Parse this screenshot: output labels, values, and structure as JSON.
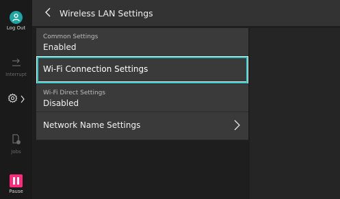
{
  "sidebar": {
    "logout_label": "Log Out",
    "interrupt_label": "Interrupt",
    "jobs_label": "Jobs",
    "pause_label": "Pause",
    "logout_color": "#1ea4a4",
    "pause_color": "#ff2b7a"
  },
  "header": {
    "title": "Wireless LAN Settings"
  },
  "settings": {
    "items": [
      {
        "label": "Common Settings",
        "value": "Enabled"
      },
      {
        "label": "Wi-Fi Connection Settings"
      },
      {
        "label": "Wi-Fi Direct Settings",
        "value": "Disabled"
      },
      {
        "label": "Network Name Settings"
      }
    ]
  },
  "accent_color": "#2ec6c6"
}
